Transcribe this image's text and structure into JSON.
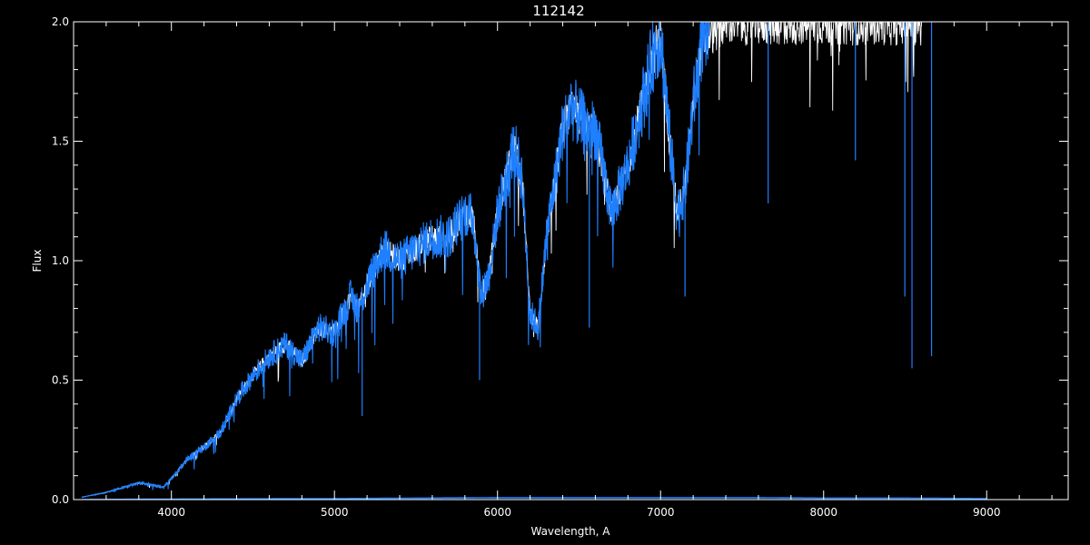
{
  "chart_data": {
    "type": "line",
    "title": "112142",
    "xlabel": "Wavelength, A",
    "ylabel": "Flux",
    "xlim": [
      3400,
      9500
    ],
    "ylim": [
      0,
      2.0
    ],
    "x_ticks": [
      4000,
      5000,
      6000,
      7000,
      8000,
      9000
    ],
    "x_tick_labels": [
      "4000",
      "5000",
      "6000",
      "7000",
      "8000",
      "9000"
    ],
    "y_ticks": [
      0,
      0.5,
      1.0,
      1.5,
      2.0
    ],
    "y_tick_labels": [
      "0.0",
      "0.5",
      "1.0",
      "1.5",
      "2.0"
    ],
    "grid": false,
    "background": "#000000",
    "axis_color": "#ffffff",
    "series": [
      {
        "style": "white",
        "color": "#ffffff",
        "x": [
          3450,
          3600,
          3700,
          3800,
          3900,
          3950,
          3990,
          4100,
          4200,
          4300,
          4400,
          4500,
          4600,
          4700,
          4800,
          4900,
          5000,
          5100,
          5150,
          5200,
          5300,
          5400,
          5500,
          5600,
          5700,
          5800,
          5850,
          5900,
          5950,
          6000,
          6100,
          6150,
          6200,
          6250,
          6300,
          6400,
          6450,
          6500,
          6550,
          6600,
          6700,
          6800,
          6900,
          6950,
          7000,
          7050,
          7100,
          7150,
          7200,
          7250,
          7300,
          7400,
          7500,
          7600,
          7700,
          7800,
          7900,
          8000,
          8100,
          8200,
          8300,
          8400,
          8500,
          8550,
          8600
        ],
        "y": [
          0.01,
          0.03,
          0.05,
          0.07,
          0.06,
          0.05,
          0.08,
          0.17,
          0.22,
          0.28,
          0.42,
          0.52,
          0.6,
          0.65,
          0.58,
          0.72,
          0.7,
          0.85,
          0.8,
          0.9,
          1.05,
          1.0,
          1.05,
          1.1,
          1.1,
          1.2,
          1.18,
          0.85,
          0.95,
          1.2,
          1.48,
          1.35,
          0.78,
          0.72,
          1.1,
          1.55,
          1.65,
          1.6,
          1.55,
          1.55,
          1.2,
          1.4,
          1.7,
          1.85,
          1.95,
          1.55,
          1.2,
          1.3,
          1.65,
          1.9,
          1.95,
          2.0,
          2.0,
          2.0,
          2.0,
          2.0,
          2.0,
          2.0,
          2.0,
          2.0,
          2.0,
          2.0,
          2.0,
          2.0,
          2.0
        ]
      },
      {
        "style": "blue",
        "color": "#1e7fff",
        "x": [
          3450,
          3600,
          3700,
          3800,
          3900,
          3950,
          3990,
          4100,
          4200,
          4300,
          4400,
          4500,
          4600,
          4700,
          4800,
          4900,
          5000,
          5100,
          5150,
          5200,
          5300,
          5400,
          5500,
          5600,
          5700,
          5800,
          5850,
          5900,
          5950,
          6000,
          6100,
          6150,
          6200,
          6250,
          6300,
          6400,
          6450,
          6500,
          6550,
          6600,
          6700,
          6800,
          6900,
          6950,
          7000,
          7050,
          7100,
          7150,
          7200,
          7250,
          7300
        ],
        "y": [
          0.01,
          0.03,
          0.05,
          0.07,
          0.06,
          0.05,
          0.08,
          0.17,
          0.22,
          0.28,
          0.42,
          0.52,
          0.6,
          0.65,
          0.58,
          0.72,
          0.7,
          0.85,
          0.8,
          0.9,
          1.05,
          1.0,
          1.05,
          1.1,
          1.1,
          1.2,
          1.18,
          0.85,
          0.95,
          1.2,
          1.48,
          1.35,
          0.78,
          0.72,
          1.1,
          1.55,
          1.65,
          1.6,
          1.55,
          1.55,
          1.2,
          1.4,
          1.7,
          1.85,
          1.95,
          1.55,
          1.2,
          1.3,
          1.65,
          1.9,
          1.95
        ]
      },
      {
        "style": "blue-error",
        "color": "#1e7fff",
        "x": [
          3450,
          4000,
          5000,
          6000,
          6500,
          7000,
          7600,
          8000,
          8500,
          9000
        ],
        "y": [
          0.0,
          0.002,
          0.004,
          0.008,
          0.008,
          0.008,
          0.008,
          0.006,
          0.006,
          0.004
        ]
      }
    ],
    "absorption_lines": [
      {
        "x": 5170,
        "depth_to": 0.35
      },
      {
        "x": 5890,
        "depth_to": 0.5
      },
      {
        "x": 6563,
        "depth_to": 0.72
      },
      {
        "x": 7150,
        "depth_to": 0.85
      },
      {
        "x": 7660,
        "depth_to": 1.24
      },
      {
        "x": 8195,
        "depth_to": 1.42
      },
      {
        "x": 8498,
        "depth_to": 0.85
      },
      {
        "x": 8542,
        "depth_to": 0.55
      },
      {
        "x": 8662,
        "depth_to": 0.6
      }
    ]
  }
}
